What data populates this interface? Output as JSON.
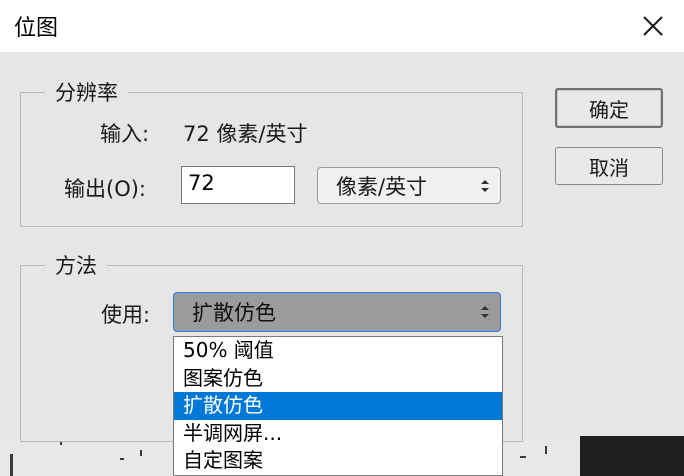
{
  "window": {
    "title": "位图",
    "close_icon": "close-icon"
  },
  "resolution": {
    "legend": "分辨率",
    "input_label": "输入:",
    "input_value": "72 像素/英寸",
    "output_label": "输出(O):",
    "output_value": "72",
    "unit_selected": "像素/英寸"
  },
  "method": {
    "legend": "方法",
    "use_label": "使用:",
    "selected": "扩散仿色",
    "options": [
      "50% 阈值",
      "图案仿色",
      "扩散仿色",
      "半调网屏...",
      "自定图案"
    ]
  },
  "buttons": {
    "ok": "确定",
    "cancel": "取消"
  },
  "colors": {
    "accent": "#0078d7",
    "focus_border": "#2b7fd6"
  }
}
